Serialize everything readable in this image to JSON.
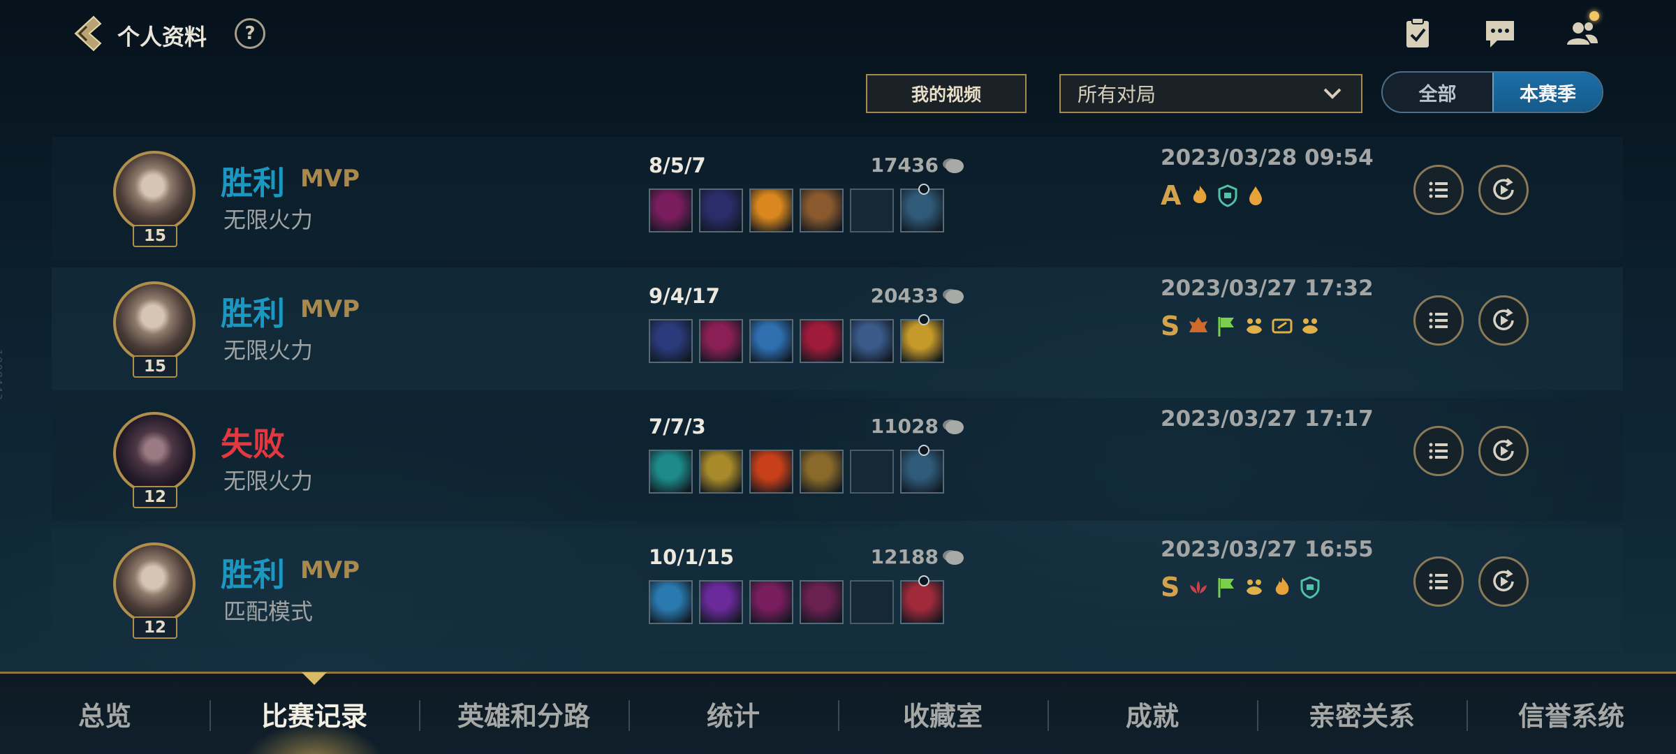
{
  "header": {
    "title": "个人资料",
    "help": "?"
  },
  "side_id": "1008443",
  "filters": {
    "video_button": "我的视频",
    "match_type": "所有对局",
    "season_toggle": [
      "全部",
      "本赛季"
    ],
    "season_selected": "本赛季"
  },
  "matches": [
    {
      "result": "胜利",
      "mvp": "MVP",
      "mode": "无限火力",
      "level": "15",
      "kda": "8/5/7",
      "gold": "17436",
      "date": "2023/03/28 09:54",
      "grade": "A",
      "items": [
        "item",
        "item",
        "item",
        "item",
        "empty",
        "trinket"
      ],
      "badges": [
        "flame",
        "shield",
        "drop"
      ]
    },
    {
      "result": "胜利",
      "mvp": "MVP",
      "mode": "无限火力",
      "level": "15",
      "kda": "9/4/17",
      "gold": "20433",
      "date": "2023/03/27 17:32",
      "grade": "S",
      "items": [
        "item",
        "item",
        "item",
        "item",
        "item",
        "trinket"
      ],
      "badges": [
        "crest",
        "flag",
        "paw",
        "ticket",
        "paw"
      ]
    },
    {
      "result": "失败",
      "mvp": "",
      "mode": "无限火力",
      "level": "12",
      "kda": "7/7/3",
      "gold": "11028",
      "date": "2023/03/27 17:17",
      "grade": "",
      "items": [
        "item",
        "item",
        "item",
        "item",
        "empty",
        "trinket"
      ],
      "badges": []
    },
    {
      "result": "胜利",
      "mvp": "MVP",
      "mode": "匹配模式",
      "level": "12",
      "kda": "10/1/15",
      "gold": "12188",
      "date": "2023/03/27 16:55",
      "grade": "S",
      "items": [
        "item",
        "item",
        "item",
        "item",
        "empty",
        "trinket"
      ],
      "badges": [
        "lotus",
        "flag",
        "paw",
        "flame",
        "shield"
      ]
    }
  ],
  "bottom_nav": [
    "总览",
    "比赛记录",
    "英雄和分路",
    "统计",
    "收藏室",
    "成就",
    "亲密关系",
    "信誉系统"
  ],
  "bottom_nav_active": "比赛记录",
  "colors": {
    "win": "#1b98c2",
    "lose": "#e2383f",
    "gold_accent": "#b08e4c",
    "active_toggle": "#1c6fa8"
  }
}
